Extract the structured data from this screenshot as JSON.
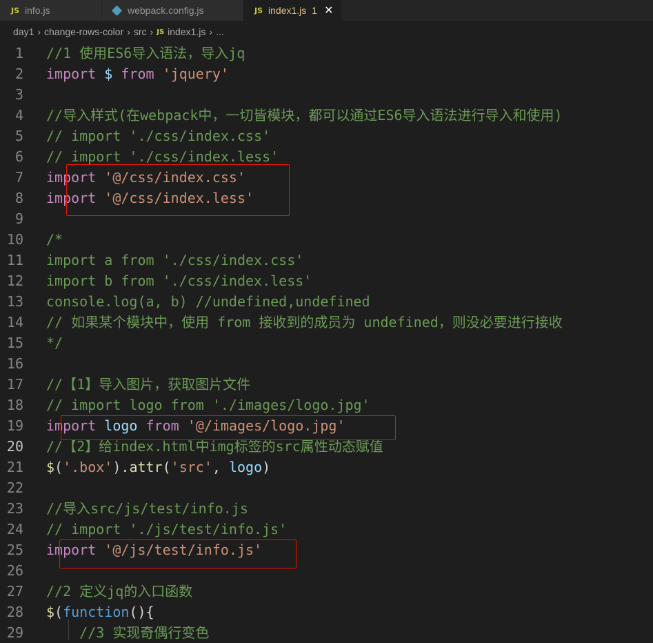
{
  "tabs": [
    {
      "icon": "JS",
      "label": "info.js"
    },
    {
      "icon": "config",
      "label": "webpack.config.js"
    },
    {
      "icon": "JS",
      "label": "index1.js",
      "badge": "1",
      "close": "✕"
    }
  ],
  "breadcrumb": [
    "day1",
    "change-rows-color",
    "src",
    "index1.js",
    "..."
  ],
  "breadcrumb_icon": "JS",
  "current_line": 20,
  "lines": [
    {
      "n": "1",
      "t": [
        [
          "com",
          "//1 使用ES6导入语法，导入jq"
        ]
      ]
    },
    {
      "n": "2",
      "t": [
        [
          "kw",
          "import"
        ],
        [
          "plain",
          " "
        ],
        [
          "var",
          "$"
        ],
        [
          "plain",
          " "
        ],
        [
          "kw",
          "from"
        ],
        [
          "plain",
          " "
        ],
        [
          "str",
          "'jquery'"
        ]
      ]
    },
    {
      "n": "3",
      "t": []
    },
    {
      "n": "4",
      "t": [
        [
          "com",
          "//导入样式(在webpack中，一切皆模块，都可以通过ES6导入语法进行导入和使用)"
        ]
      ]
    },
    {
      "n": "5",
      "t": [
        [
          "com",
          "// import './css/index.css'"
        ]
      ]
    },
    {
      "n": "6",
      "t": [
        [
          "com",
          "// import './css/index.less'"
        ]
      ]
    },
    {
      "n": "7",
      "t": [
        [
          "kw",
          "import"
        ],
        [
          "plain",
          " "
        ],
        [
          "str",
          "'@/css/index.css'"
        ]
      ]
    },
    {
      "n": "8",
      "t": [
        [
          "kw",
          "import"
        ],
        [
          "plain",
          " "
        ],
        [
          "str",
          "'@/css/index.less'"
        ]
      ]
    },
    {
      "n": "9",
      "t": []
    },
    {
      "n": "10",
      "t": [
        [
          "com",
          "/*"
        ]
      ]
    },
    {
      "n": "11",
      "t": [
        [
          "com",
          "import a from './css/index.css'"
        ]
      ]
    },
    {
      "n": "12",
      "t": [
        [
          "com",
          "import b from './css/index.less'"
        ]
      ]
    },
    {
      "n": "13",
      "t": [
        [
          "com",
          "console.log(a, b) //undefined,undefined"
        ]
      ]
    },
    {
      "n": "14",
      "t": [
        [
          "com",
          "// 如果某个模块中，使用 from 接收到的成员为 undefined，则没必要进行接收"
        ]
      ]
    },
    {
      "n": "15",
      "t": [
        [
          "com",
          "*/"
        ]
      ]
    },
    {
      "n": "16",
      "t": []
    },
    {
      "n": "17",
      "t": [
        [
          "com",
          "//【1】导入图片，获取图片文件"
        ]
      ]
    },
    {
      "n": "18",
      "t": [
        [
          "com",
          "// import logo from './images/logo.jpg'"
        ]
      ]
    },
    {
      "n": "19",
      "t": [
        [
          "kw",
          "import"
        ],
        [
          "plain",
          " "
        ],
        [
          "var",
          "logo"
        ],
        [
          "plain",
          " "
        ],
        [
          "kw",
          "from"
        ],
        [
          "plain",
          " "
        ],
        [
          "str",
          "'@/images/logo.jpg'"
        ]
      ]
    },
    {
      "n": "20",
      "t": [
        [
          "com",
          "//【2】给index.html中img标签的src属性动态赋值"
        ]
      ]
    },
    {
      "n": "21",
      "t": [
        [
          "fn",
          "$"
        ],
        [
          "plain",
          "("
        ],
        [
          "str",
          "'.box'"
        ],
        [
          "plain",
          ")."
        ],
        [
          "fn",
          "attr"
        ],
        [
          "plain",
          "("
        ],
        [
          "str",
          "'src'"
        ],
        [
          "plain",
          ", "
        ],
        [
          "var",
          "logo"
        ],
        [
          "plain",
          ")"
        ]
      ]
    },
    {
      "n": "22",
      "t": []
    },
    {
      "n": "23",
      "t": [
        [
          "com",
          "//导入src/js/test/info.js"
        ]
      ]
    },
    {
      "n": "24",
      "t": [
        [
          "com",
          "// import './js/test/info.js'"
        ]
      ]
    },
    {
      "n": "25",
      "t": [
        [
          "kw",
          "import"
        ],
        [
          "plain",
          " "
        ],
        [
          "str",
          "'@/js/test/info.js'"
        ]
      ]
    },
    {
      "n": "26",
      "t": []
    },
    {
      "n": "27",
      "t": [
        [
          "com",
          "//2 定义jq的入口函数"
        ]
      ]
    },
    {
      "n": "28",
      "t": [
        [
          "fn",
          "$"
        ],
        [
          "plain",
          "("
        ],
        [
          "blue",
          "function"
        ],
        [
          "plain",
          "(){"
        ]
      ]
    },
    {
      "n": "29",
      "t": [
        [
          "plain",
          "    "
        ],
        [
          "com",
          "//3 实现奇偶行变色"
        ]
      ]
    }
  ]
}
